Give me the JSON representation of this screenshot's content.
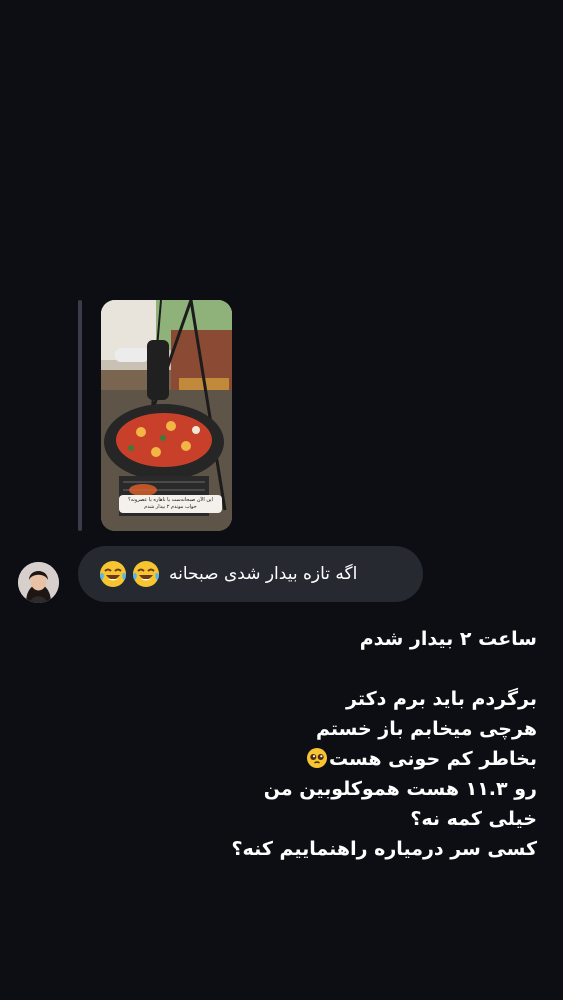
{
  "story_reply": {
    "caption": "این الآن صبحانه‌ست یا ناهاره یا عصرونه؟ خواب موندم ۲ بیدار شدم",
    "image_description_icon": "story-image-icon"
  },
  "incoming_message": {
    "text": "اگه تازه بیدار شدی صبحانه",
    "emoji": "face-with-tears-of-joy-icon"
  },
  "outgoing_message": {
    "line1": "ساعت ۲ بیدار شدم",
    "line2": "",
    "line3": "برگردم باید برم دکتر",
    "line4": "هرچی میخابم باز خستم",
    "line5": "بخاطر کم حونی هست",
    "line6": "رو ۱۱.۳ هست هموکلوبین من",
    "line7": "خیلی کمه نه؟",
    "line8": "کسی سر درمیاره راهنماییم کنه؟",
    "line5_emoji": "pleading-face-icon"
  }
}
